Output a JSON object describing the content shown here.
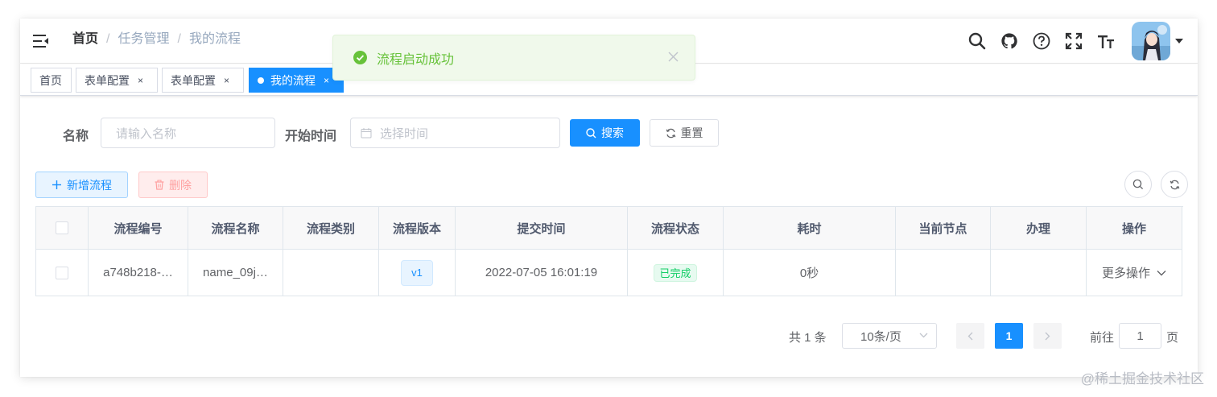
{
  "navbar": {
    "breadcrumb": [
      "首页",
      "任务管理",
      "我的流程"
    ],
    "separator": "/"
  },
  "tags": [
    {
      "label": "首页",
      "closable": false,
      "active": false
    },
    {
      "label": "表单配置",
      "closable": true,
      "active": false
    },
    {
      "label": "表单配置",
      "closable": true,
      "active": false
    },
    {
      "label": "我的流程",
      "closable": true,
      "active": true
    }
  ],
  "tag_close": "×",
  "toast": {
    "message": "流程启动成功",
    "type": "success"
  },
  "search": {
    "name_label": "名称",
    "name_placeholder": "请输入名称",
    "time_label": "开始时间",
    "time_placeholder": "选择时间",
    "search_button": "搜索",
    "reset_button": "重置"
  },
  "toolbar": {
    "add_button": "新增流程",
    "delete_button": "删除"
  },
  "table": {
    "columns": [
      "流程编号",
      "流程名称",
      "流程类别",
      "流程版本",
      "提交时间",
      "流程状态",
      "耗时",
      "当前节点",
      "办理",
      "操作"
    ],
    "rows": [
      {
        "id": "a748b218-…",
        "name": "name_09j…",
        "category": "",
        "version": "v1",
        "submit_time": "2022-07-05 16:01:19",
        "status": "已完成",
        "duration": "0秒",
        "current_node": "",
        "handle": "",
        "action": "更多操作"
      }
    ]
  },
  "pagination": {
    "total_text": "共 1 条",
    "page_size": "10条/页",
    "current_page": "1",
    "goto_label": "前往",
    "goto_value": "1",
    "page_suffix": "页"
  },
  "watermark": "@稀土掘金技术社区",
  "colors": {
    "primary": "#1890ff",
    "success": "#67c23a",
    "danger": "#ff4949"
  }
}
